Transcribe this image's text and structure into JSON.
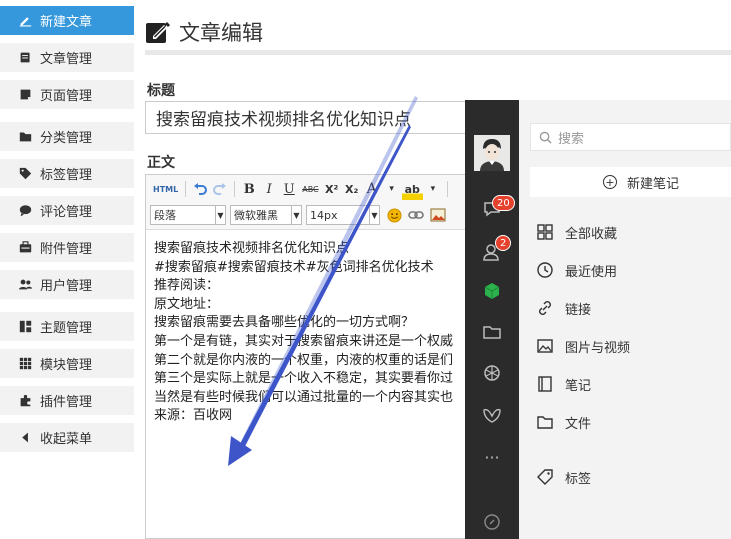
{
  "sidebar": {
    "items": [
      {
        "label": "新建文章",
        "icon": "edit-icon",
        "active": true
      },
      {
        "label": "文章管理",
        "icon": "article-icon"
      },
      {
        "label": "页面管理",
        "icon": "page-icon"
      },
      {
        "label": "分类管理",
        "icon": "folder-icon"
      },
      {
        "label": "标签管理",
        "icon": "tag-icon"
      },
      {
        "label": "评论管理",
        "icon": "comment-icon"
      },
      {
        "label": "附件管理",
        "icon": "attachment-icon"
      },
      {
        "label": "用户管理",
        "icon": "users-icon"
      },
      {
        "label": "主题管理",
        "icon": "theme-icon"
      },
      {
        "label": "模块管理",
        "icon": "module-icon"
      },
      {
        "label": "插件管理",
        "icon": "plugin-icon"
      },
      {
        "label": "收起菜单",
        "icon": "collapse-icon"
      }
    ]
  },
  "main": {
    "page_title": "文章编辑",
    "title_label": "标题",
    "title_value": "搜索留痕技术视频排名优化知识点",
    "body_label": "正文"
  },
  "editor": {
    "toolbar": {
      "html": "HTML",
      "bold": "B",
      "italic": "I",
      "underline": "U",
      "strike": "ABC",
      "superscript": "X²",
      "subscript": "X₂",
      "font_color": "A",
      "highlight": "ab"
    },
    "paragraph_select": "段落",
    "font_family_select": "微软雅黑",
    "font_size_select": "14px",
    "lines": [
      "搜索留痕技术视频排名优化知识点",
      "#搜索留痕#搜索留痕技术#灰色词排名优化技术",
      "推荐阅读：",
      "原文地址：",
      "搜索留痕需要去具备哪些优化的一切方式啊？",
      "第一个是有链，其实对于搜索留痕来讲还是一个权威",
      "第二个就是你内液的一个权重，内液的权重的话是们",
      "第三个是实际上就是一个收入不稳定，其实要看你过",
      "当然是有些时候我们可以通过批量的一个内容其实也",
      "来源：百收网"
    ]
  },
  "notes_panel": {
    "badge_messages": "20",
    "badge_contacts": "2",
    "search_placeholder": "搜索",
    "new_note_label": "新建笔记",
    "menu": [
      {
        "label": "全部收藏",
        "icon": "grid-icon"
      },
      {
        "label": "最近使用",
        "icon": "clock-icon"
      },
      {
        "label": "链接",
        "icon": "link-icon"
      },
      {
        "label": "图片与视频",
        "icon": "image-icon"
      },
      {
        "label": "笔记",
        "icon": "note-icon"
      },
      {
        "label": "文件",
        "icon": "file-folder-icon"
      },
      {
        "label": "标签",
        "icon": "tag-outline-icon"
      }
    ]
  },
  "colors": {
    "active_nav": "#3598dc",
    "rail": "#2b2b2b",
    "badge": "#e5412d",
    "arrow": "#3d55c8",
    "green_cube": "#2bb24c"
  }
}
